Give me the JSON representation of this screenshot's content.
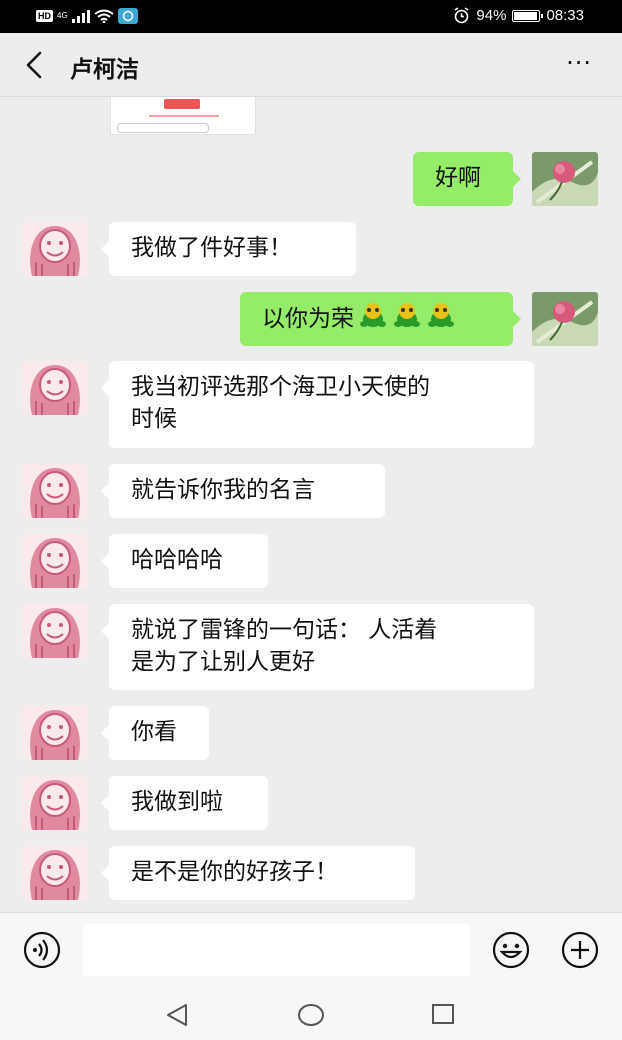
{
  "status": {
    "hd": "HD",
    "network": "4G",
    "battery": "94%",
    "battery_level": 0.94,
    "time": "08:33"
  },
  "header": {
    "title": "卢柯洁",
    "more": "···"
  },
  "messages": [
    {
      "side": "right",
      "text": "好啊"
    },
    {
      "side": "left",
      "text": "我做了件好事！"
    },
    {
      "side": "right",
      "text": "以你为荣",
      "emojis": 3
    },
    {
      "side": "left",
      "line1": "我当初评选那个海卫小天使的",
      "line2": "时候"
    },
    {
      "side": "left",
      "text": "就告诉你我的名言"
    },
    {
      "side": "left",
      "text": "哈哈哈哈"
    },
    {
      "side": "left",
      "line1": "就说了雷锋的一句话： 人活着",
      "line2": "是为了让别人更好"
    },
    {
      "side": "left",
      "text": "你看"
    },
    {
      "side": "left",
      "text": "我做到啦"
    },
    {
      "side": "left",
      "text": "是不是你的好孩子！"
    }
  ],
  "input": {
    "placeholder": ""
  },
  "colors": {
    "outgoing_bubble": "#95ec69",
    "incoming_bubble": "#ffffff",
    "chat_background": "#ededed"
  }
}
